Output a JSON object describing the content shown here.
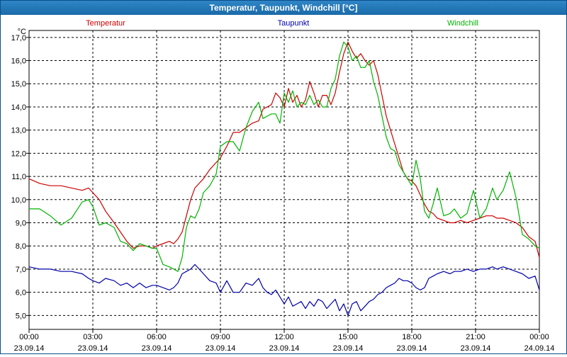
{
  "window": {
    "title": "Temperatur, Taupunkt, Windchill [°C]"
  },
  "chart_data": {
    "type": "line",
    "title": "Temperatur, Taupunkt, Windchill [°C]",
    "unit_label": "°C",
    "ylim": [
      4.4,
      17.3
    ],
    "y_ticks": [
      "17,0",
      "16,0",
      "15,0",
      "14,0",
      "13,0",
      "12,0",
      "11,0",
      "10,0",
      "9,0",
      "8,0",
      "7,0",
      "6,0",
      "5,0"
    ],
    "y_tick_values": [
      17,
      16,
      15,
      14,
      13,
      12,
      11,
      10,
      9,
      8,
      7,
      6,
      5
    ],
    "x_range_hours": [
      0,
      24
    ],
    "x_ticks": [
      {
        "time": "00:00",
        "date": "23.09.14"
      },
      {
        "time": "03:00",
        "date": "23.09.14"
      },
      {
        "time": "06:00",
        "date": "23.09.14"
      },
      {
        "time": "09:00",
        "date": "23.09.14"
      },
      {
        "time": "12:00",
        "date": "23.09.14"
      },
      {
        "time": "15:00",
        "date": "23.09.14"
      },
      {
        "time": "18:00",
        "date": "23.09.14"
      },
      {
        "time": "21:00",
        "date": "23.09.14"
      },
      {
        "time": "00:00",
        "date": "24.09.14"
      }
    ],
    "x_tick_hours": [
      0,
      3,
      6,
      9,
      12,
      15,
      18,
      21,
      24
    ],
    "grid": true,
    "series": [
      {
        "name": "Temperatur",
        "color": "#cc0000",
        "x": [
          0,
          0.5,
          1,
          1.5,
          2,
          2.5,
          2.8,
          3,
          3.3,
          3.6,
          4,
          4.3,
          4.6,
          4.9,
          5.2,
          5.5,
          5.8,
          6,
          6.3,
          6.6,
          6.8,
          7,
          7.2,
          7.4,
          7.6,
          7.8,
          8,
          8.2,
          8.5,
          8.8,
          9,
          9.3,
          9.6,
          9.9,
          10.2,
          10.5,
          10.8,
          11,
          11.2,
          11.4,
          11.6,
          11.8,
          12,
          12.2,
          12.4,
          12.6,
          12.8,
          13,
          13.2,
          13.4,
          13.6,
          13.8,
          14,
          14.2,
          14.4,
          14.6,
          14.8,
          15,
          15.2,
          15.4,
          15.6,
          15.8,
          16,
          16.2,
          16.4,
          16.6,
          16.8,
          17,
          17.2,
          17.4,
          17.6,
          17.8,
          18,
          18.2,
          18.4,
          18.6,
          18.8,
          19,
          19.2,
          19.5,
          19.8,
          20,
          20.3,
          20.6,
          20.9,
          21.2,
          21.5,
          21.8,
          22,
          22.3,
          22.6,
          22.9,
          23.2,
          23.5,
          23.8,
          24
        ],
        "values": [
          10.9,
          10.7,
          10.6,
          10.6,
          10.5,
          10.4,
          10.5,
          10.3,
          10.0,
          9.5,
          9.0,
          8.6,
          8.2,
          7.9,
          8.0,
          8.0,
          7.9,
          8.0,
          8.1,
          8.2,
          8.1,
          8.3,
          8.6,
          9.3,
          10.0,
          10.5,
          10.7,
          10.9,
          11.3,
          11.6,
          11.8,
          12.3,
          12.9,
          12.9,
          13.1,
          13.3,
          13.4,
          13.9,
          14.0,
          14.1,
          14.6,
          14.4,
          14.0,
          14.8,
          14.2,
          14.5,
          14.0,
          14.3,
          15.1,
          14.6,
          14.0,
          14.5,
          14.5,
          14.1,
          14.6,
          15.5,
          16.3,
          16.8,
          16.4,
          16.1,
          16.3,
          16.0,
          15.8,
          16.0,
          15.4,
          14.5,
          13.6,
          13.0,
          12.4,
          11.8,
          11.2,
          10.9,
          10.8,
          10.6,
          10.2,
          9.8,
          9.5,
          9.4,
          9.2,
          9.1,
          9.0,
          9.0,
          9.1,
          9.0,
          9.1,
          9.2,
          9.3,
          9.3,
          9.2,
          9.2,
          9.1,
          9.0,
          8.8,
          8.4,
          8.2,
          7.5
        ]
      },
      {
        "name": "Taupunkt",
        "color": "#0000aa",
        "x": [
          0,
          0.5,
          1,
          1.5,
          2,
          2.5,
          2.8,
          3,
          3.3,
          3.6,
          4,
          4.3,
          4.6,
          4.9,
          5.2,
          5.5,
          5.8,
          6,
          6.3,
          6.6,
          6.8,
          7,
          7.2,
          7.4,
          7.6,
          7.8,
          8,
          8.2,
          8.5,
          8.8,
          9,
          9.3,
          9.6,
          9.9,
          10.2,
          10.5,
          10.8,
          11,
          11.2,
          11.4,
          11.6,
          11.8,
          12,
          12.2,
          12.4,
          12.6,
          12.8,
          13,
          13.2,
          13.4,
          13.6,
          13.8,
          14,
          14.2,
          14.4,
          14.6,
          14.8,
          15,
          15.2,
          15.4,
          15.6,
          15.8,
          16,
          16.2,
          16.4,
          16.6,
          16.8,
          17,
          17.2,
          17.4,
          17.6,
          17.8,
          18,
          18.2,
          18.4,
          18.6,
          18.8,
          19,
          19.2,
          19.5,
          19.8,
          20,
          20.3,
          20.6,
          20.9,
          21.2,
          21.5,
          21.8,
          22,
          22.3,
          22.6,
          22.9,
          23.2,
          23.5,
          23.8,
          24
        ],
        "values": [
          7.1,
          7.0,
          7.0,
          6.9,
          6.9,
          6.8,
          6.6,
          6.5,
          6.4,
          6.6,
          6.5,
          6.3,
          6.4,
          6.2,
          6.4,
          6.2,
          6.3,
          6.3,
          6.2,
          6.1,
          6.2,
          6.4,
          6.8,
          6.9,
          7.0,
          7.2,
          7.0,
          6.8,
          6.5,
          6.4,
          6.0,
          6.5,
          6.0,
          6.0,
          6.4,
          6.3,
          6.6,
          6.2,
          6.0,
          5.9,
          6.1,
          5.8,
          5.5,
          5.8,
          5.4,
          5.5,
          5.6,
          5.3,
          5.6,
          5.4,
          5.7,
          5.6,
          5.3,
          5.5,
          5.7,
          5.2,
          5.5,
          5.0,
          5.5,
          5.6,
          5.2,
          5.4,
          5.6,
          5.7,
          5.9,
          6.0,
          6.2,
          6.3,
          6.4,
          6.6,
          6.5,
          6.5,
          6.4,
          6.2,
          6.1,
          6.2,
          6.6,
          6.7,
          6.8,
          6.9,
          6.8,
          6.9,
          6.9,
          7.0,
          6.9,
          7.0,
          7.0,
          7.1,
          7.0,
          7.1,
          7.0,
          6.9,
          6.8,
          6.6,
          6.7,
          6.1
        ]
      },
      {
        "name": "Windchill",
        "color": "#00b400",
        "x": [
          0,
          0.5,
          1,
          1.5,
          2,
          2.5,
          2.8,
          3,
          3.3,
          3.6,
          4,
          4.3,
          4.6,
          4.9,
          5.2,
          5.5,
          5.8,
          6,
          6.3,
          6.6,
          6.8,
          7,
          7.2,
          7.4,
          7.6,
          7.8,
          8,
          8.2,
          8.5,
          8.8,
          9,
          9.3,
          9.6,
          9.9,
          10.2,
          10.5,
          10.8,
          11,
          11.2,
          11.4,
          11.6,
          11.8,
          12,
          12.2,
          12.4,
          12.6,
          12.8,
          13,
          13.2,
          13.4,
          13.6,
          13.8,
          14,
          14.2,
          14.4,
          14.6,
          14.8,
          15,
          15.2,
          15.4,
          15.6,
          15.8,
          16,
          16.2,
          16.4,
          16.6,
          16.8,
          17,
          17.2,
          17.4,
          17.6,
          17.8,
          18,
          18.2,
          18.4,
          18.6,
          18.8,
          19,
          19.2,
          19.5,
          19.8,
          20,
          20.3,
          20.6,
          20.9,
          21.2,
          21.5,
          21.8,
          22,
          22.3,
          22.6,
          22.9,
          23.2,
          23.5,
          23.8,
          24
        ],
        "values": [
          9.6,
          9.6,
          9.3,
          8.9,
          9.2,
          9.9,
          10.0,
          9.7,
          8.9,
          9.0,
          8.8,
          8.2,
          8.1,
          7.8,
          8.1,
          8.0,
          7.9,
          7.9,
          7.2,
          7.1,
          7.0,
          6.9,
          7.5,
          8.8,
          9.3,
          9.2,
          9.6,
          10.3,
          10.6,
          11.1,
          12.3,
          12.5,
          12.5,
          12.1,
          13.1,
          13.8,
          14.2,
          13.5,
          13.6,
          13.7,
          13.7,
          13.3,
          14.6,
          14.2,
          14.7,
          14.0,
          14.2,
          14.1,
          14.5,
          14.1,
          14.3,
          14.0,
          14.0,
          14.8,
          15.2,
          16.2,
          16.8,
          16.6,
          16.0,
          16.2,
          15.7,
          15.7,
          16.0,
          15.1,
          14.5,
          13.6,
          12.7,
          12.2,
          12.1,
          11.5,
          11.2,
          10.9,
          10.6,
          11.7,
          10.9,
          9.5,
          9.2,
          9.8,
          10.5,
          9.3,
          9.4,
          9.6,
          9.2,
          9.4,
          10.4,
          9.2,
          9.6,
          10.5,
          10.0,
          10.4,
          11.2,
          10.1,
          8.5,
          8.3,
          8.0,
          7.9
        ]
      }
    ]
  }
}
